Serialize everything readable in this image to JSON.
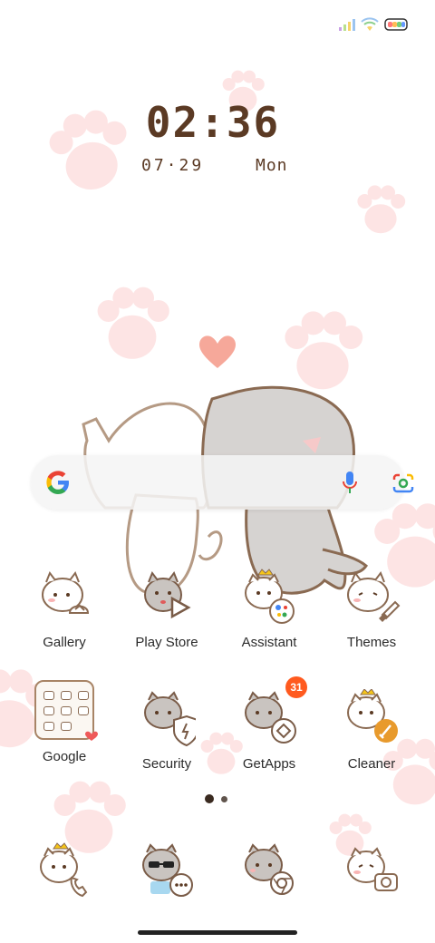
{
  "lockscreen_widget": {
    "time": "02:36",
    "date": "07·29",
    "weekday": "Mon"
  },
  "status_bar": {
    "icons": [
      "signal-icon",
      "wifi-icon",
      "battery-icon"
    ],
    "battery_colors": [
      "#f77",
      "#fb5",
      "#7c7",
      "#69f"
    ]
  },
  "search_widget": {
    "icons": [
      "google-logo-icon",
      "microphone-icon",
      "google-lens-icon"
    ]
  },
  "apps_row1": [
    {
      "label": "Gallery",
      "icon": "gallery-icon"
    },
    {
      "label": "Play Store",
      "icon": "play-store-icon"
    },
    {
      "label": "Assistant",
      "icon": "assistant-icon"
    },
    {
      "label": "Themes",
      "icon": "themes-icon"
    }
  ],
  "apps_row2": [
    {
      "label": "Google",
      "icon": "google-folder-icon"
    },
    {
      "label": "Security",
      "icon": "security-icon"
    },
    {
      "label": "GetApps",
      "icon": "getapps-icon",
      "badge": "31"
    },
    {
      "label": "Cleaner",
      "icon": "cleaner-icon"
    }
  ],
  "dock": [
    {
      "icon": "phone-icon"
    },
    {
      "icon": "messages-icon"
    },
    {
      "icon": "browser-icon"
    },
    {
      "icon": "camera-icon"
    }
  ],
  "page_indicator": {
    "pages": 2,
    "current": 1
  },
  "colors": {
    "clock_text": "#5b3a24",
    "paw": "#fde4e4",
    "badge": "#ff5a1f",
    "cat_outline": "#8a6a52",
    "gray_cat": "#d6d3d1"
  }
}
